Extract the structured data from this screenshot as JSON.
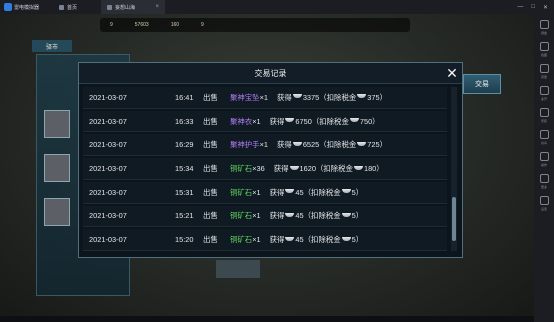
{
  "emulator": {
    "app_name": "雷电模拟器",
    "tabs": [
      {
        "label": "首页"
      },
      {
        "label": "妄想山海"
      }
    ],
    "window_controls": [
      "—",
      "□",
      "✕"
    ],
    "side_tools": [
      "键盘",
      "截图",
      "音量",
      "多开",
      "安装",
      "共享",
      "操作",
      "更多",
      "设置"
    ]
  },
  "game": {
    "resources": [
      "9",
      "57603",
      "160",
      "9"
    ],
    "panel_header": "驿市",
    "right_button": "交易"
  },
  "modal": {
    "title": "交易记录",
    "close_symbol": "✕",
    "records": [
      {
        "date": "2021-03-07",
        "time": "16:41",
        "action": "出售",
        "item": "聚神宝坠",
        "item_color": "#b07cf2",
        "qty": "×1",
        "gain_label": "获得",
        "gain": "3375",
        "tax_label": "（扣除税金",
        "tax": "375）"
      },
      {
        "date": "2021-03-07",
        "time": "16:33",
        "action": "出售",
        "item": "聚神衣",
        "item_color": "#b07cf2",
        "qty": "×1",
        "gain_label": "获得",
        "gain": "6750",
        "tax_label": "（扣除税金",
        "tax": "750）"
      },
      {
        "date": "2021-03-07",
        "time": "16:29",
        "action": "出售",
        "item": "聚神护手",
        "item_color": "#b07cf2",
        "qty": "×1",
        "gain_label": "获得",
        "gain": "6525",
        "tax_label": "（扣除税金",
        "tax": "725）"
      },
      {
        "date": "2021-03-07",
        "time": "15:34",
        "action": "出售",
        "item": "铜矿石",
        "item_color": "#5fd35f",
        "qty": "×36",
        "gain_label": "获得",
        "gain": "1620",
        "tax_label": "（扣除税金",
        "tax": "180）"
      },
      {
        "date": "2021-03-07",
        "time": "15:31",
        "action": "出售",
        "item": "铜矿石",
        "item_color": "#5fd35f",
        "qty": "×1",
        "gain_label": "获得",
        "gain": "45",
        "tax_label": "（扣除税金",
        "tax": "5）"
      },
      {
        "date": "2021-03-07",
        "time": "15:21",
        "action": "出售",
        "item": "铜矿石",
        "item_color": "#5fd35f",
        "qty": "×1",
        "gain_label": "获得",
        "gain": "45",
        "tax_label": "（扣除税金",
        "tax": "5）"
      },
      {
        "date": "2021-03-07",
        "time": "15:20",
        "action": "出售",
        "item": "铜矿石",
        "item_color": "#5fd35f",
        "qty": "×1",
        "gain_label": "获得",
        "gain": "45",
        "tax_label": "（扣除税金",
        "tax": "5）"
      }
    ]
  }
}
